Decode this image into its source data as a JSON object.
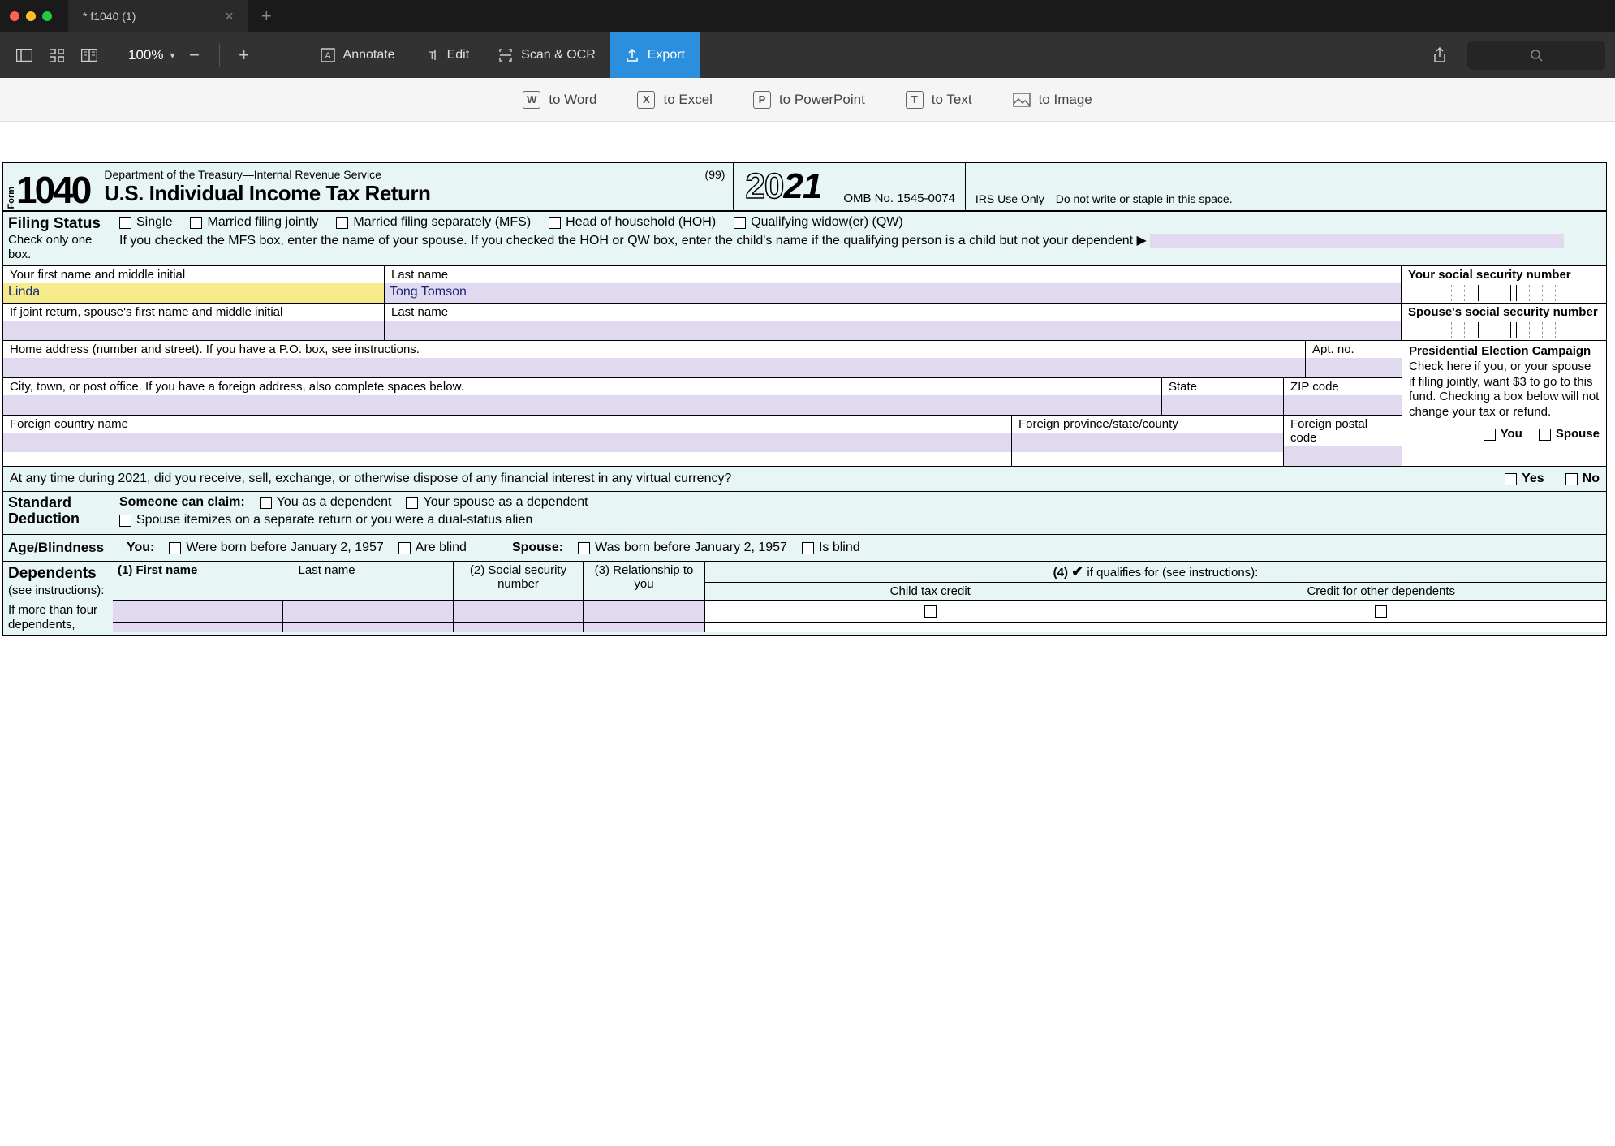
{
  "window": {
    "tab_title": "* f1040 (1)"
  },
  "toolbar": {
    "zoom": "100%",
    "annotate": "Annotate",
    "edit": "Edit",
    "scan": "Scan & OCR",
    "export": "Export"
  },
  "subtoolbar": {
    "word": "to Word",
    "excel": "to Excel",
    "powerpoint": "to PowerPoint",
    "text": "to Text",
    "image": "to Image",
    "keys": {
      "word": "W",
      "excel": "X",
      "powerpoint": "P",
      "text": "T"
    }
  },
  "form": {
    "form_label": "Form",
    "form_number": "1040",
    "dept": "Department of the Treasury—Internal Revenue Service",
    "code99": "(99)",
    "title": "U.S. Individual Income Tax Return",
    "year_a": "20",
    "year_b": "21",
    "omb": "OMB No. 1545-0074",
    "irs_use": "IRS Use Only—Do not write or staple in this space.",
    "filing_status": {
      "title": "Filing Status",
      "sub": "Check only one box.",
      "single": "Single",
      "mfj": "Married filing jointly",
      "mfs": "Married filing separately (MFS)",
      "hoh": "Head of household (HOH)",
      "qw": "Qualifying widow(er) (QW)",
      "note": "If you checked the MFS box, enter the name of your spouse. If you checked the HOH or QW box, enter the child's name if the qualifying person is a child but not your dependent ▶"
    },
    "name": {
      "first_label": "Your first name and middle initial",
      "first_value": "Linda",
      "last_label": "Last name",
      "last_value": "Tong Tomson",
      "ssn_label": "Your social security number",
      "spouse_first_label": "If joint return, spouse's first name and middle initial",
      "spouse_last_label": "Last name",
      "spouse_ssn_label": "Spouse's social security number"
    },
    "address": {
      "home_label": "Home address (number and street). If you have a P.O. box, see instructions.",
      "apt_label": "Apt. no.",
      "city_label": "City, town, or post office. If you have a foreign address, also complete spaces below.",
      "state_label": "State",
      "zip_label": "ZIP code",
      "foreign_country_label": "Foreign country name",
      "foreign_province_label": "Foreign province/state/county",
      "foreign_postal_label": "Foreign postal code"
    },
    "presidential": {
      "title": "Presidential Election Campaign",
      "text": "Check here if you, or your spouse if filing jointly, want $3 to go to this fund. Checking a box below will not change your tax or refund.",
      "you": "You",
      "spouse": "Spouse"
    },
    "virtual_currency": {
      "question": "At any time during 2021, did you receive, sell, exchange, or otherwise dispose of any financial interest in any virtual currency?",
      "yes": "Yes",
      "no": "No"
    },
    "standard_deduction": {
      "title_a": "Standard",
      "title_b": "Deduction",
      "someone": "Someone can claim:",
      "you_dep": "You as a dependent",
      "spouse_dep": "Your spouse as a dependent",
      "itemize": "Spouse itemizes on a separate return or you were a dual-status alien"
    },
    "age_blindness": {
      "title": "Age/Blindness",
      "you": "You:",
      "you_born": "Were born before January 2, 1957",
      "you_blind": "Are blind",
      "spouse": "Spouse:",
      "spouse_born": "Was born before January 2, 1957",
      "spouse_blind": "Is blind"
    },
    "dependents": {
      "title": "Dependents",
      "see": "(see instructions):",
      "more": "If more than four dependents,",
      "col1": "(1) First name",
      "col1b": "Last name",
      "col2": "(2) Social security number",
      "col3": "(3) Relationship to you",
      "col4": "(4) ✔ if qualifies for (see instructions):",
      "col4a": "Child tax credit",
      "col4b": "Credit for other dependents"
    }
  }
}
